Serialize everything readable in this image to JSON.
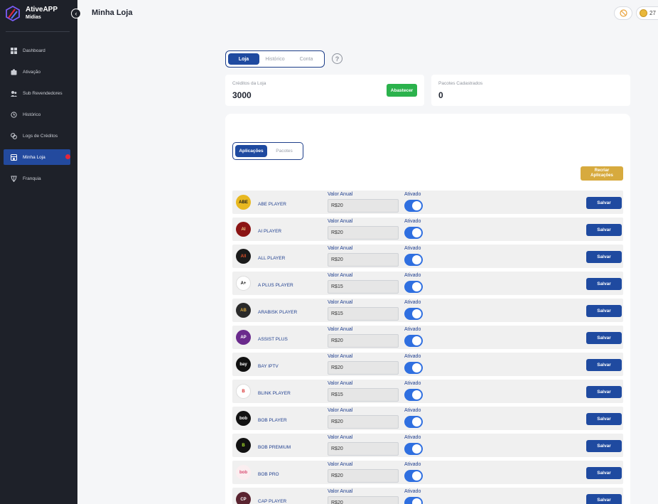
{
  "brand": {
    "title": "AtiveAPP",
    "subtitle": "Midias"
  },
  "sidebar": {
    "items": [
      {
        "label": "Dashboard",
        "icon": "dashboard-icon"
      },
      {
        "label": "Ativação",
        "icon": "activation-icon"
      },
      {
        "label": "Sub Revendedores",
        "icon": "users-icon"
      },
      {
        "label": "Histórico",
        "icon": "history-icon"
      },
      {
        "label": "Logs de Créditos",
        "icon": "credit-logs-icon"
      },
      {
        "label": "Minha Loja",
        "icon": "store-icon",
        "active": true
      },
      {
        "label": "Franquia",
        "icon": "franchise-icon"
      }
    ]
  },
  "header": {
    "title": "Minha Loja",
    "credits_badge": "27"
  },
  "tabs": [
    "Loja",
    "Histórico",
    "Conta"
  ],
  "stats": {
    "store_credits_label": "Créditos da Loja",
    "store_credits_value": "3000",
    "refill_button": "Abastecer",
    "packages_label": "Pacotes Cadastrados",
    "packages_value": "0"
  },
  "sub_tabs": [
    "Aplicações",
    "Pacotes"
  ],
  "recreate_button": [
    "Recriar",
    "Aplicações"
  ],
  "field_labels": {
    "price": "Valor Anual",
    "enabled": "Ativado",
    "save": "Salvar"
  },
  "colors": {
    "sidebar_bg": "#1e2129",
    "primary": "#1f4aa0",
    "green": "#2bb24c",
    "gold": "#d7aa3e",
    "toggle_on": "#2f6fe0"
  },
  "apps": [
    {
      "name": "ABE PLAYER",
      "price": "R$20",
      "enabled": true,
      "logo_text": "ABE",
      "logo_bg": "#e8b820",
      "logo_fg": "#1a1a1a"
    },
    {
      "name": "AI PLAYER",
      "price": "R$20",
      "enabled": true,
      "logo_text": "AI",
      "logo_bg": "#8b1414",
      "logo_fg": "#f2d28a"
    },
    {
      "name": "ALL PLAYER",
      "price": "R$20",
      "enabled": true,
      "logo_text": "All",
      "logo_bg": "#1a1a1a",
      "logo_fg": "#e0502a"
    },
    {
      "name": "A PLUS PLAYER",
      "price": "R$15",
      "enabled": true,
      "logo_text": "A+",
      "logo_bg": "#ffffff",
      "logo_fg": "#111111"
    },
    {
      "name": "ARABISK PLAYER",
      "price": "R$15",
      "enabled": true,
      "logo_text": "AB",
      "logo_bg": "#2a2a2a",
      "logo_fg": "#d9a840"
    },
    {
      "name": "ASSIST PLUS",
      "price": "R$20",
      "enabled": true,
      "logo_text": "AP",
      "logo_bg": "#6a2a8c",
      "logo_fg": "#ffffff"
    },
    {
      "name": "BAY IPTV",
      "price": "R$20",
      "enabled": true,
      "logo_text": "bay",
      "logo_bg": "#111111",
      "logo_fg": "#ffffff"
    },
    {
      "name": "BLINK PLAYER",
      "price": "R$15",
      "enabled": true,
      "logo_text": "B",
      "logo_bg": "#ffffff",
      "logo_fg": "#d83030"
    },
    {
      "name": "BOB PLAYER",
      "price": "R$20",
      "enabled": true,
      "logo_text": "bob",
      "logo_bg": "#111111",
      "logo_fg": "#ffffff"
    },
    {
      "name": "BOB PREMIUM",
      "price": "R$20",
      "enabled": true,
      "logo_text": "B",
      "logo_bg": "#111111",
      "logo_fg": "#a6e02a"
    },
    {
      "name": "BOB PRO",
      "price": "R$20",
      "enabled": true,
      "logo_text": "bob",
      "logo_bg": "#fbeef0",
      "logo_fg": "#d84a70"
    },
    {
      "name": "CAP PLAYER",
      "price": "R$20",
      "enabled": true,
      "logo_text": "CP",
      "logo_bg": "#5a2430",
      "logo_fg": "#ffffff"
    }
  ]
}
